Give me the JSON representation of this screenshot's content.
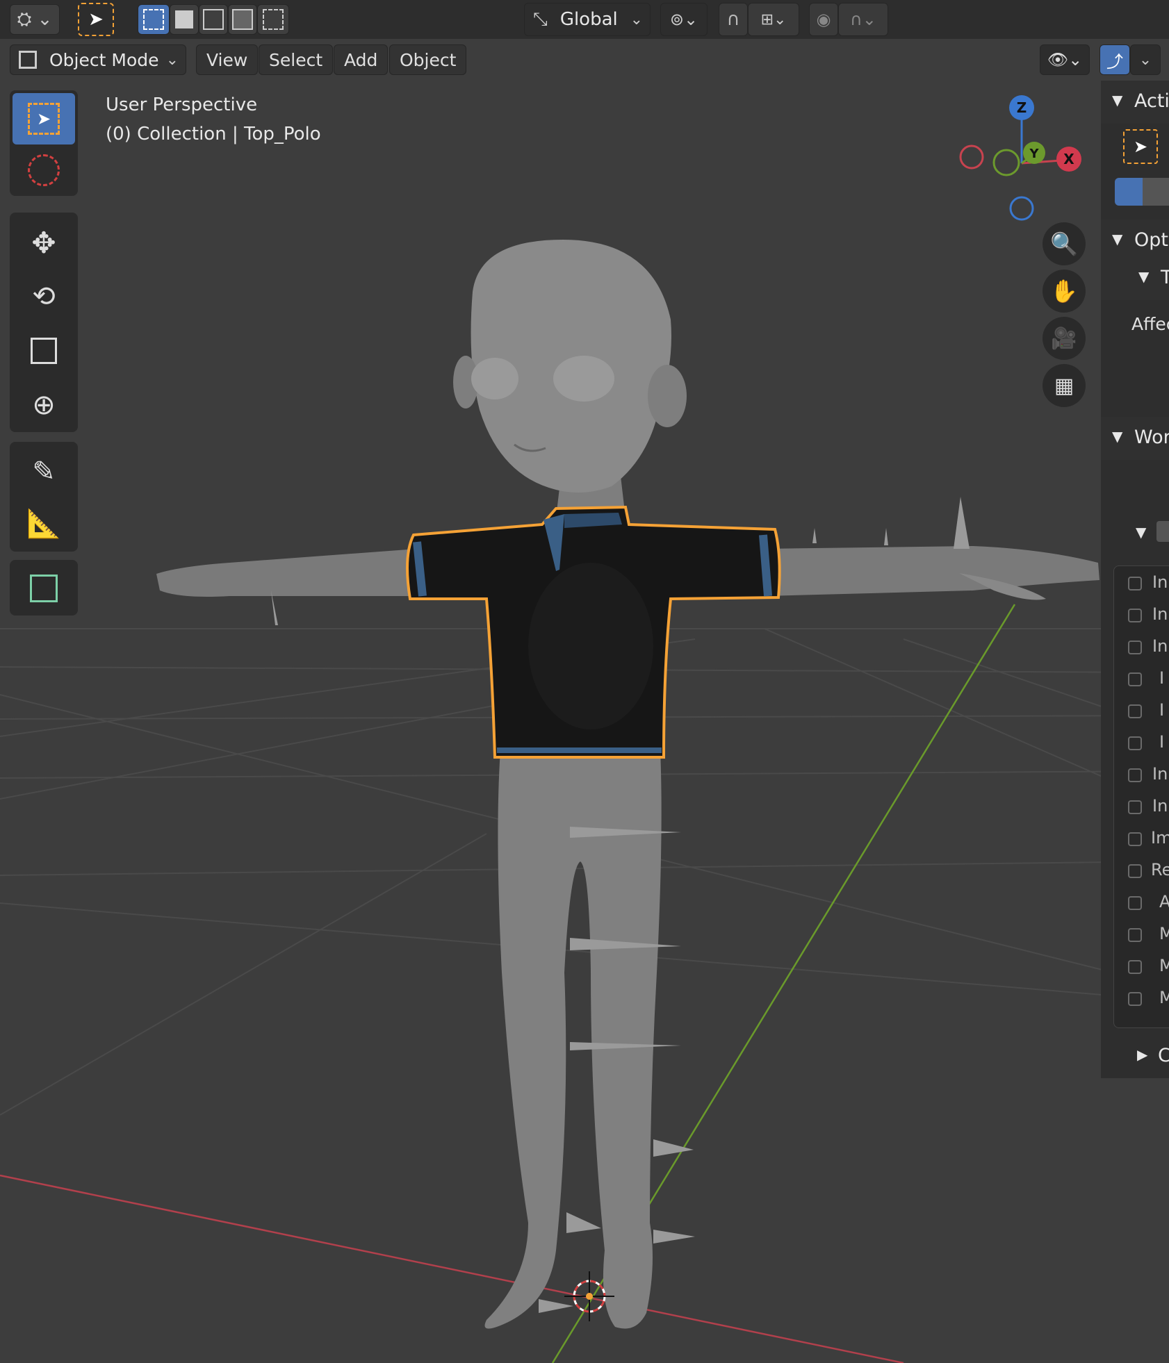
{
  "header": {
    "transform_orientation": "Global",
    "mode": "Object Mode",
    "menus": [
      "View",
      "Select",
      "Add",
      "Object"
    ]
  },
  "overlay": {
    "view_name": "User Perspective",
    "collection_info": "(0) Collection | Top_Polo"
  },
  "gizmo": {
    "z": "Z",
    "y": "Y",
    "x": "X"
  },
  "sidebar": {
    "sections": [
      "Acti",
      "Opt",
      "Tr",
      "Affec",
      "Wor",
      "C"
    ],
    "checkbox_labels": [
      "In",
      "In",
      "In",
      "I",
      "I",
      "I",
      "In",
      "In",
      "Im",
      "Re",
      "A",
      "M",
      "M",
      "M"
    ]
  },
  "colors": {
    "selection": "#f5a236",
    "accent": "#4772b3",
    "x_axis": "#c8434f",
    "y_axis": "#6c9a2d"
  }
}
